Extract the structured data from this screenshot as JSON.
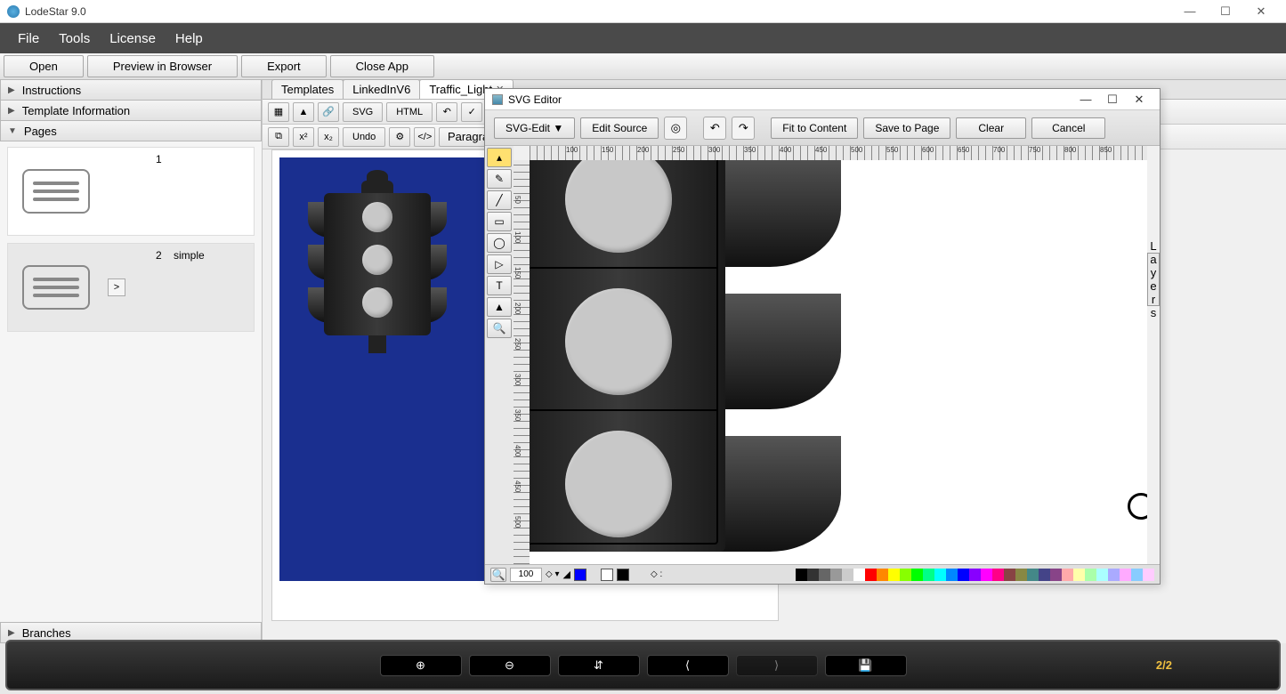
{
  "app": {
    "title": "LodeStar 9.0"
  },
  "window_controls": {
    "min": "—",
    "max": "☐",
    "close": "✕"
  },
  "menu": [
    "File",
    "Tools",
    "License",
    "Help"
  ],
  "toolbar1": {
    "open": "Open",
    "preview": "Preview in Browser",
    "export": "Export",
    "close": "Close App"
  },
  "sidebar": {
    "sections": {
      "instructions": "Instructions",
      "templateinfo": "Template Information",
      "pages": "Pages",
      "branches": "Branches"
    },
    "pages": [
      {
        "num": "1",
        "name": ""
      },
      {
        "num": "2",
        "name": "simple"
      }
    ],
    "move_char": ">"
  },
  "tabs": [
    {
      "label": "Templates",
      "closable": false
    },
    {
      "label": "LinkedInV6",
      "closable": false
    },
    {
      "label": "Traffic_Light",
      "closable": true,
      "active": true
    }
  ],
  "editor_toolbar": {
    "svg": "SVG",
    "html": "HTML",
    "undo": "Undo",
    "paragraph": "Paragraph"
  },
  "dialog": {
    "title": "SVG Editor",
    "buttons": {
      "svgedit": "SVG-Edit ▼",
      "editsource": "Edit Source",
      "fit": "Fit to Content",
      "save": "Save to Page",
      "clear": "Clear",
      "cancel": "Cancel"
    },
    "layers_label": "Layers",
    "zoom": "100",
    "ruler_h": [
      "",
      "100",
      "150",
      "200",
      "250",
      "300",
      "350",
      "400",
      "450",
      "500",
      "550",
      "600",
      "650",
      "700",
      "750",
      "800",
      "850"
    ],
    "ruler_v": [
      "",
      "50",
      "100",
      "150",
      "200",
      "250",
      "300",
      "350",
      "400",
      "450",
      "500"
    ]
  },
  "palette": [
    "#000",
    "#333",
    "#666",
    "#999",
    "#ccc",
    "#fff",
    "#f00",
    "#f80",
    "#ff0",
    "#8f0",
    "#0f0",
    "#0f8",
    "#0ff",
    "#08f",
    "#00f",
    "#80f",
    "#f0f",
    "#f08",
    "#844",
    "#884",
    "#488",
    "#448",
    "#848",
    "#faa",
    "#ffa",
    "#afa",
    "#aff",
    "#aaf",
    "#faf",
    "#8cf",
    "#fcf"
  ],
  "bottom": {
    "page": "2/2"
  }
}
